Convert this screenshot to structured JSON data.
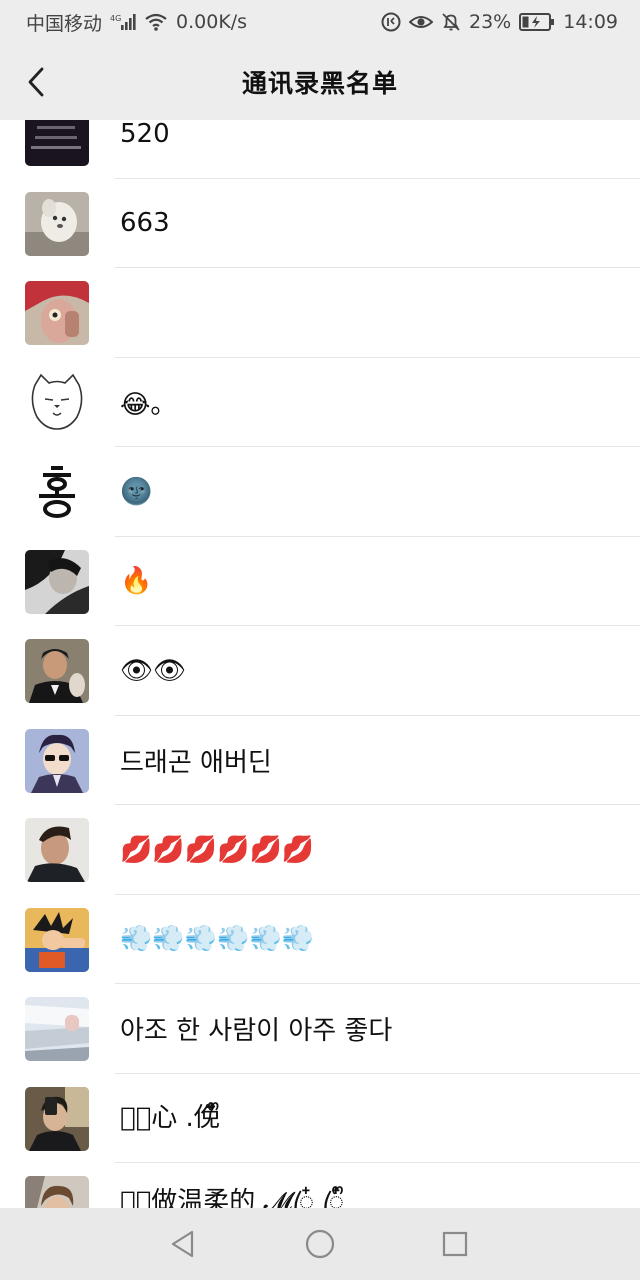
{
  "status_bar": {
    "carrier": "中国移动",
    "network": "4G",
    "speed": "0.00K/s",
    "battery": "23%",
    "time": "14:09"
  },
  "nav": {
    "title": "通讯录黑名单"
  },
  "contacts": [
    {
      "name": "520",
      "avatar": "dark-text-avatar"
    },
    {
      "name": "663",
      "avatar": "dog-photo-avatar"
    },
    {
      "name": "",
      "avatar": "red-hair-person-avatar"
    },
    {
      "name": "😂。",
      "avatar": "cat-drawing-avatar"
    },
    {
      "name": "🌚",
      "avatar": "hangul-character-avatar"
    },
    {
      "name": "🔥",
      "avatar": "dark-portrait-avatar"
    },
    {
      "name": "👁👁",
      "avatar": "man-suit-avatar"
    },
    {
      "name": "드래곤 애버딘",
      "avatar": "anime-sunglasses-avatar"
    },
    {
      "name": "💋💋💋💋💋💋",
      "avatar": "man-portrait-avatar"
    },
    {
      "name": "💨💨💨💨💨💨",
      "avatar": "anime-fighter-avatar"
    },
    {
      "name": "아조  한 사람이 아주 좋다",
      "avatar": "white-hair-avatar"
    },
    {
      "name": "𝓜ꦿ心 .俛໋໋ᩚ",
      "avatar": "selfie-avatar"
    },
    {
      "name": "𝓜ꦿ做温柔的 𝓜ꦿ໋ ꦿ໋ᩚ",
      "avatar": "young-man-avatar"
    }
  ],
  "colors": {
    "bar_bg": "#ededed",
    "divider": "#e5e5e5",
    "text": "#111111"
  }
}
